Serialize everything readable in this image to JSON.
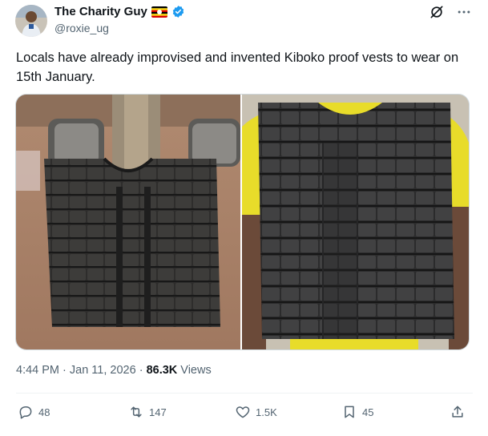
{
  "author": {
    "display_name": "The Charity Guy",
    "handle": "@roxie_ug",
    "avatar_icon": "avatar-photo",
    "flag_icon": "uganda-flag-icon",
    "verified_icon": "verified-badge-icon"
  },
  "tweet": {
    "text": "Locals have already improvised and invented Kiboko proof vests to wear on 15th January.",
    "time": "4:44 PM",
    "date": "Jan 11, 2026",
    "views_count": "86.3K",
    "views_label": "Views"
  },
  "media": [
    {
      "name": "vest-on-floor-photo"
    },
    {
      "name": "vest-worn-photo"
    }
  ],
  "actions": {
    "replies": "48",
    "reposts": "147",
    "likes": "1.5K",
    "bookmarks": "45"
  },
  "colors": {
    "text": "#0f1419",
    "secondary": "#536471",
    "verified": "#1d9bf0",
    "border": "#cfd9de"
  }
}
